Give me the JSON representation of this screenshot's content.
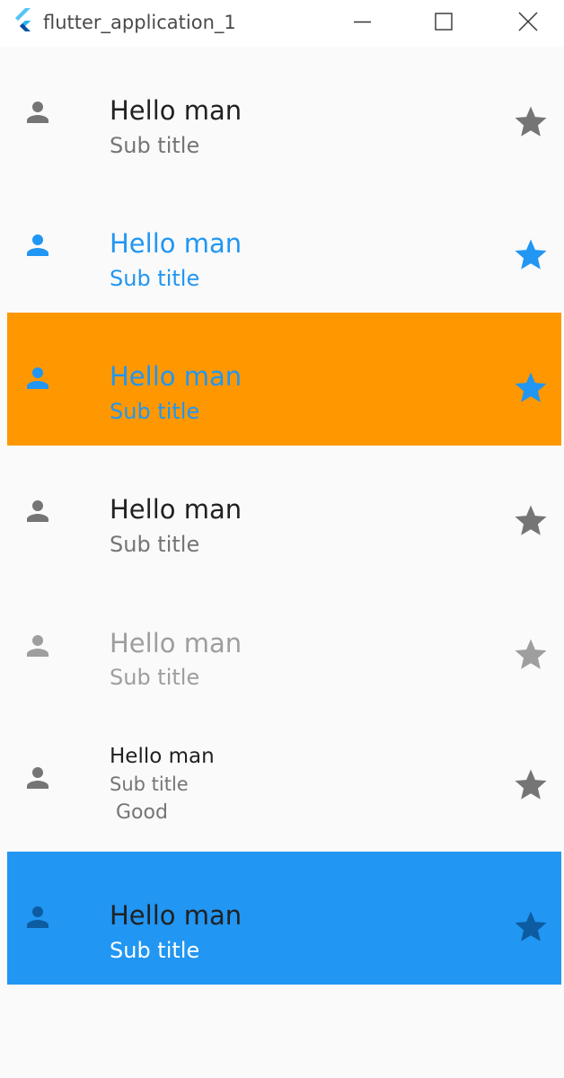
{
  "window": {
    "title": "flutter_application_1",
    "icons": {
      "logo": "flutter-logo-icon",
      "minimize": "minimize-icon",
      "maximize": "maximize-icon",
      "close": "close-icon"
    }
  },
  "colors": {
    "background": "#fafafa",
    "default_text": "#212121",
    "secondary_text": "#757575",
    "icon_grey": "#757575",
    "accent_blue": "#2196f3",
    "orange": "#ff9800",
    "disabled_text": "#9e9e9e",
    "dark_blue": "#0d5ba0",
    "white": "#ffffff"
  },
  "tiles": [
    {
      "title": "Hello man",
      "subtitle": "Sub title",
      "leading_icon": "person-icon",
      "trailing_icon": "star-icon",
      "state": "default"
    },
    {
      "title": "Hello man",
      "subtitle": "Sub title",
      "leading_icon": "person-icon",
      "trailing_icon": "star-icon",
      "state": "selected"
    },
    {
      "title": "Hello man",
      "subtitle": "Sub title",
      "leading_icon": "person-icon",
      "trailing_icon": "star-icon",
      "state": "selected-tile-color"
    },
    {
      "title": "Hello man",
      "subtitle": "Sub title",
      "leading_icon": "person-icon",
      "trailing_icon": "star-icon",
      "state": "default"
    },
    {
      "title": "Hello man",
      "subtitle": "Sub title",
      "leading_icon": "person-icon",
      "trailing_icon": "star-icon",
      "state": "disabled"
    },
    {
      "title": "Hello man",
      "subtitle": "Sub title",
      "extra": " Good",
      "leading_icon": "person-icon",
      "trailing_icon": "star-icon",
      "state": "dense-three-line"
    },
    {
      "title": "Hello man",
      "subtitle": "Sub title",
      "leading_icon": "person-icon",
      "trailing_icon": "star-icon",
      "state": "custom-colors"
    }
  ]
}
